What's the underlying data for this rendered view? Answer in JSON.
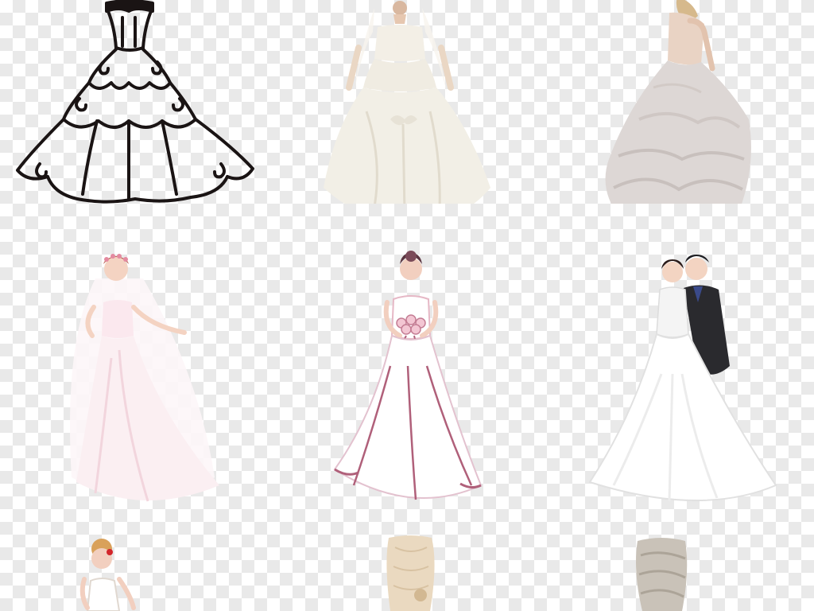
{
  "image": {
    "kind": "transparent-background clipart collage",
    "background": {
      "pattern": "checkerboard",
      "light": "#ffffff",
      "dark": "#e9e9e9"
    },
    "items": [
      {
        "name": "line-art-wedding-gown",
        "color": "#1a1414"
      },
      {
        "name": "ivory-ball-gown-bride",
        "color": "#f2efe6"
      },
      {
        "name": "blush-ruffled-gown-bride",
        "color": "#d9d3d1"
      },
      {
        "name": "cartoon-bride-with-veil",
        "color": "#fbeff2"
      },
      {
        "name": "cartoon-bride-with-bouquet",
        "color": "#b0607a"
      },
      {
        "name": "cartoon-bride-and-groom",
        "color": "#2a2a2e"
      },
      {
        "name": "cartoon-bride-partial",
        "color": "#d9a15a"
      },
      {
        "name": "champagne-lace-bodice",
        "color": "#ead9c0"
      },
      {
        "name": "satin-strapless-bodice",
        "color": "#c9c2b8"
      }
    ]
  }
}
